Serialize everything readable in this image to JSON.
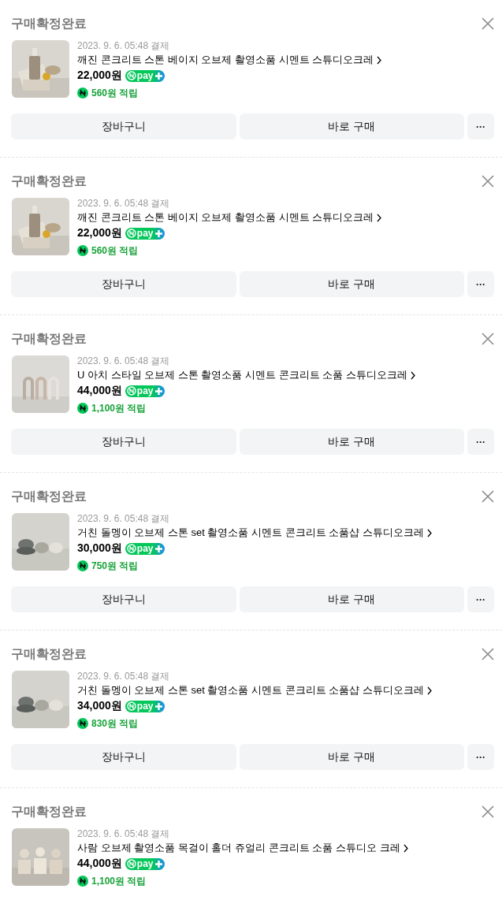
{
  "orders": [
    {
      "status": "구매확정완료",
      "date": "2023. 9. 6. 05:48 결제",
      "title": "깨진 콘크리트 스톤 베이지 오브제 촬영소품 시멘트 스튜디오크레",
      "price": "22,000원",
      "pay_badge": "pay",
      "points": "560원 적립",
      "buttons": [
        "장바구니",
        "바로 구매",
        "···"
      ]
    },
    {
      "status": "구매확정완료",
      "date": "2023. 9. 6. 05:48 결제",
      "title": "깨진 콘크리트 스톤 베이지 오브제 촬영소품 시멘트 스튜디오크레",
      "price": "22,000원",
      "pay_badge": "pay",
      "points": "560원 적립",
      "buttons": [
        "장바구니",
        "바로 구매",
        "···"
      ]
    },
    {
      "status": "구매확정완료",
      "date": "2023. 9. 6. 05:48 결제",
      "title": "U 아치 스타일 오브제 스톤 촬영소품 시멘트 콘크리트 소품 스튜디오크레",
      "price": "44,000원",
      "pay_badge": "pay",
      "points": "1,100원 적립",
      "buttons": [
        "장바구니",
        "바로 구매",
        "···"
      ]
    },
    {
      "status": "구매확정완료",
      "date": "2023. 9. 6. 05:48 결제",
      "title": "거친 돌멩이 오브제 스톤 set 촬영소품 시멘트 콘크리트 소품샵 스튜디오크레",
      "price": "30,000원",
      "pay_badge": "pay",
      "points": "750원 적립",
      "buttons": [
        "장바구니",
        "바로 구매",
        "···"
      ]
    },
    {
      "status": "구매확정완료",
      "date": "2023. 9. 6. 05:48 결제",
      "title": "거친 돌멩이 오브제 스톤 set 촬영소품 시멘트 콘크리트 소품샵 스튜디오크레",
      "price": "34,000원",
      "pay_badge": "pay",
      "points": "830원 적립",
      "buttons": [
        "장바구니",
        "바로 구매",
        "···"
      ]
    },
    {
      "status": "구매확정완료",
      "date": "2023. 9. 6. 05:48 결제",
      "title": "사람 오브제 촬영소품 목걸이 홀더 쥬얼리 콘크리트 소품 스튜디오 크레",
      "price": "44,000원",
      "pay_badge": "pay",
      "points": "1,100원 적립"
    }
  ]
}
